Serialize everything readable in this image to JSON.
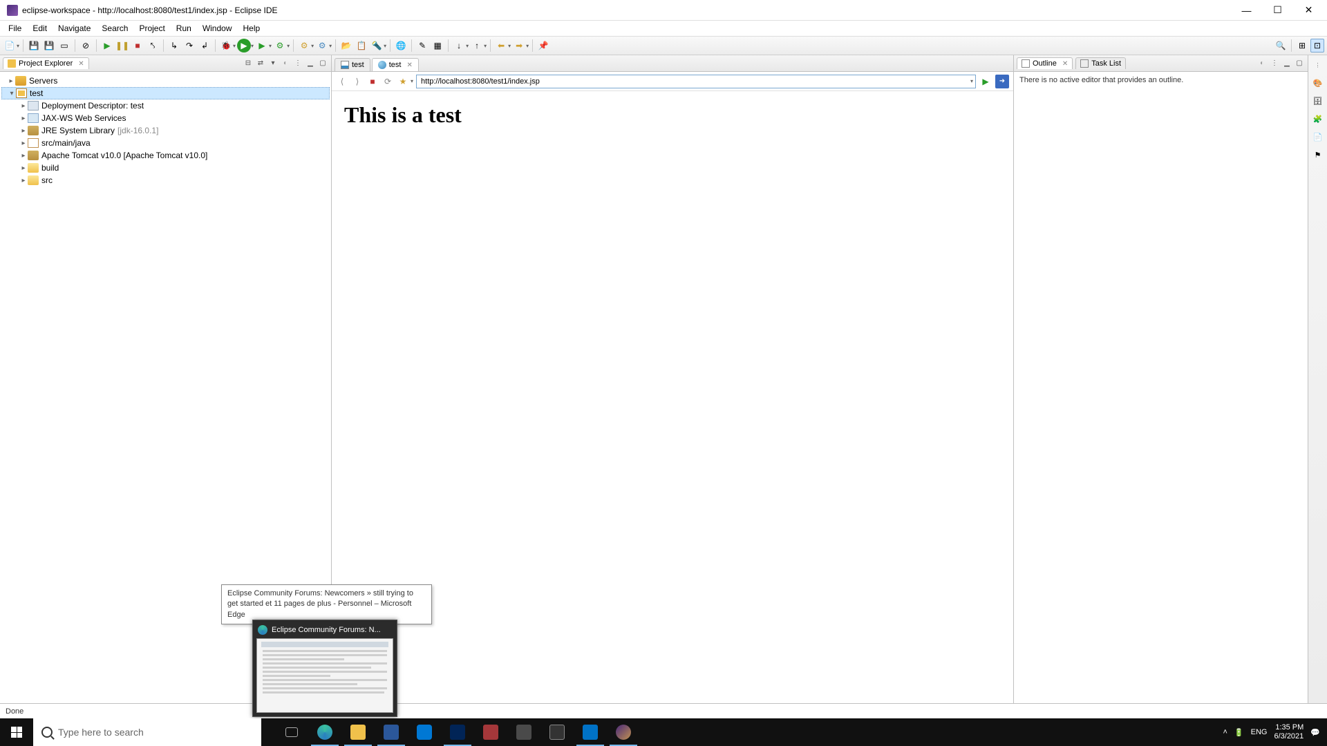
{
  "titlebar": {
    "text": "eclipse-workspace - http://localhost:8080/test1/index.jsp - Eclipse IDE"
  },
  "menu": [
    "File",
    "Edit",
    "Navigate",
    "Search",
    "Project",
    "Run",
    "Window",
    "Help"
  ],
  "project_explorer": {
    "title": "Project Explorer",
    "tree": {
      "servers": "Servers",
      "test": "test",
      "dd": "Deployment Descriptor: test",
      "jaxws": "JAX-WS Web Services",
      "jre": "JRE System Library",
      "jre_ver": "[jdk-16.0.1]",
      "srcmain": "src/main/java",
      "tomcat": "Apache Tomcat v10.0 [Apache Tomcat v10.0]",
      "build": "build",
      "src": "src"
    }
  },
  "editor": {
    "tab1": "test",
    "tab2": "test",
    "url": "http://localhost:8080/test1/index.jsp",
    "page_heading": "This is a test"
  },
  "outline": {
    "title": "Outline",
    "tasklist": "Task List",
    "msg": "There is no active editor that provides an outline."
  },
  "status": {
    "text": "Done"
  },
  "tooltip": {
    "text": "Eclipse Community Forums: Newcomers » still trying to get started et 11 pages de plus - Personnel – Microsoft Edge"
  },
  "thumb": {
    "title": "Eclipse Community Forums: N..."
  },
  "taskbar": {
    "search_placeholder": "Type here to search",
    "lang": "ENG",
    "time": "1:35 PM",
    "date": "6/3/2021"
  }
}
